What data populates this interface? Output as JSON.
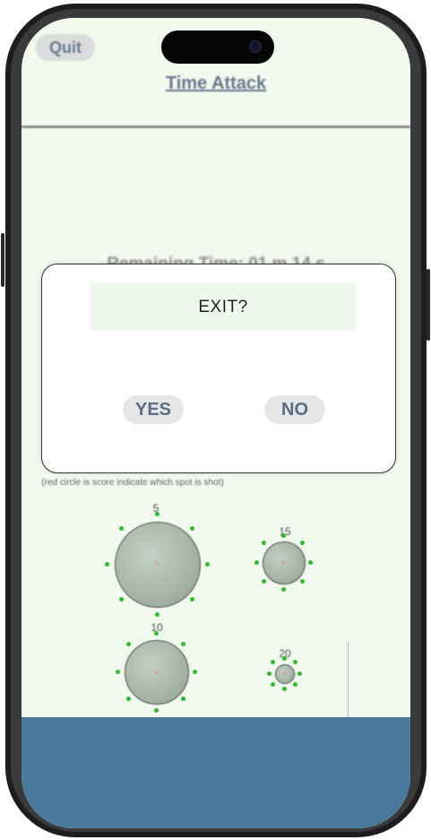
{
  "header": {
    "quit_label": "Quit",
    "title": "Time Attack"
  },
  "game": {
    "remaining_time_text": "Remaining Time: 01 m 14 s",
    "hint_text": "(red circle is score indicate which spot is shot)",
    "targets": [
      {
        "score_label": "5"
      },
      {
        "score_label": "15"
      },
      {
        "score_label": "10"
      },
      {
        "score_label": "20"
      }
    ]
  },
  "dialog": {
    "title": "EXIT?",
    "yes_label": "YES",
    "no_label": "NO"
  },
  "colors": {
    "background": "#f1f8ee",
    "bottom_band": "#4a7a9b",
    "target_dots": "#2bbd2b",
    "button_text": "#5b6e84"
  }
}
